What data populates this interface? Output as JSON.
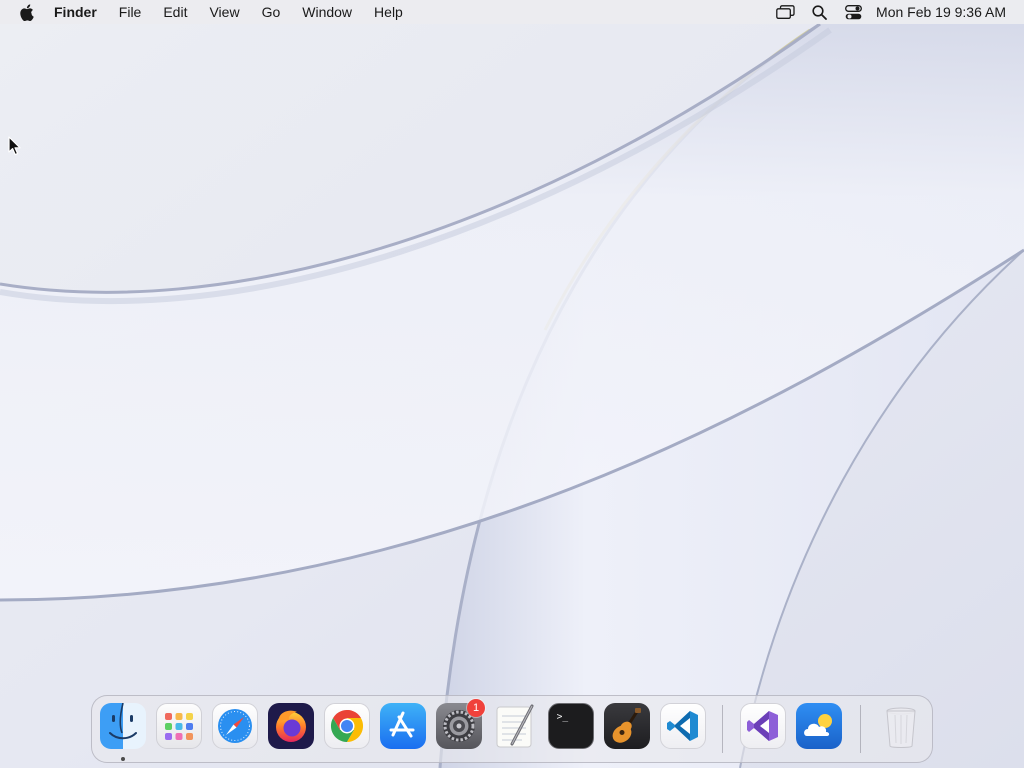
{
  "menubar": {
    "apple_icon": "apple-logo-icon",
    "app_name": "Finder",
    "menus": [
      "File",
      "Edit",
      "View",
      "Go",
      "Window",
      "Help"
    ],
    "status_icons": [
      "screen-mirroring-icon",
      "spotlight-search-icon",
      "control-center-icon"
    ],
    "clock": "Mon Feb 19  9:36 AM"
  },
  "cursor_icon": "arrow-pointer-icon",
  "dock": {
    "apps": [
      {
        "name": "Finder",
        "icon": "finder-icon",
        "running": true
      },
      {
        "name": "Launchpad",
        "icon": "launchpad-icon"
      },
      {
        "name": "Safari",
        "icon": "safari-icon"
      },
      {
        "name": "Firefox",
        "icon": "firefox-icon"
      },
      {
        "name": "Google Chrome",
        "icon": "chrome-icon"
      },
      {
        "name": "App Store",
        "icon": "app-store-icon"
      },
      {
        "name": "System Settings",
        "icon": "system-settings-icon",
        "badge": "1"
      },
      {
        "name": "TextEdit",
        "icon": "textedit-icon"
      },
      {
        "name": "Terminal",
        "icon": "terminal-icon"
      },
      {
        "name": "GarageBand",
        "icon": "garageband-icon"
      },
      {
        "name": "Visual Studio Code",
        "icon": "vscode-icon"
      },
      {
        "name": "Visual Studio",
        "icon": "visual-studio-icon"
      },
      {
        "name": "Weather",
        "icon": "weather-icon"
      },
      {
        "name": "Trash",
        "icon": "trash-icon"
      }
    ],
    "terminal_prompt": ">_"
  },
  "colors": {
    "desktop_base": "#e4e6ef",
    "menubar": "#ecECf0",
    "badge": "#f0413b",
    "accent_blue": "#1b8cf2"
  }
}
